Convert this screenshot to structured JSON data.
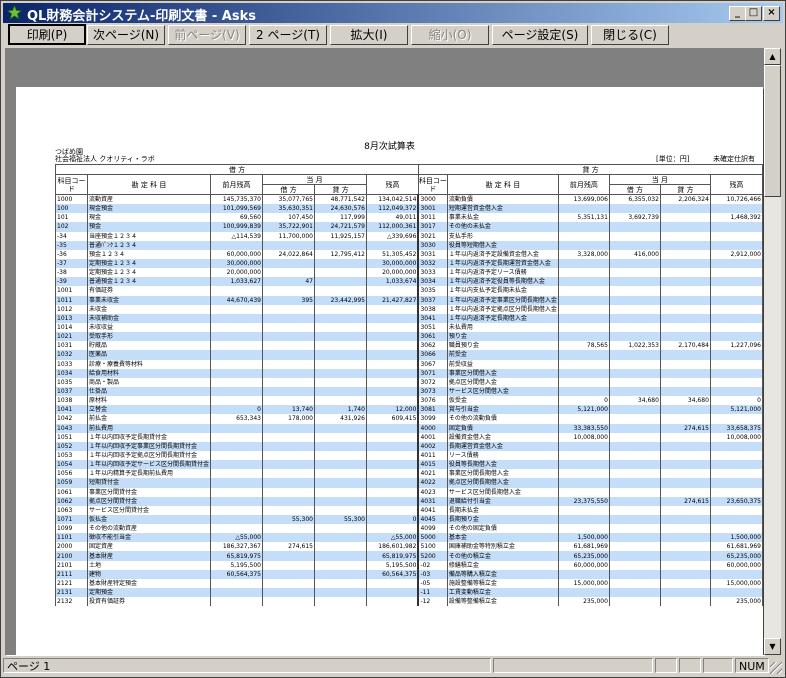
{
  "window": {
    "title": "QL財務会計システム-印刷文書 - Asks",
    "min_icon": "minimize-icon",
    "max_icon": "maximize-icon",
    "close_icon": "close-icon"
  },
  "toolbar": {
    "print": "印刷(P)",
    "next_page": "次ページ(N)",
    "prev_page": "前ページ(V)",
    "two_page": "2 ページ(T)",
    "zoom_in": "拡大(I)",
    "zoom_out": "縮小(O)",
    "page_setup": "ページ設定(S)",
    "close": "閉じる(C)"
  },
  "document": {
    "title": "8月次試算表",
    "company1": "つばめ園",
    "company2": "社会福祉法人 クオリティ・ラボ",
    "unit": "[単位：円]",
    "status": "未確定仕訳有",
    "left_header": "借 方",
    "right_header": "貸 方",
    "col_code": "科目コード",
    "col_name": "勘 定 科 目",
    "col_prev": "前月残高",
    "col_month": "当 月",
    "col_debit": "借 方",
    "col_credit": "貸 方",
    "col_bal": "残高",
    "rows": [
      [
        "1000",
        "流動資産",
        "145,735,370",
        "35,077,765",
        "48,771,542",
        "134,042,514",
        "3000",
        "流動負債",
        "13,699,006",
        "6,355,032",
        "2,206,324",
        "10,726,466"
      ],
      [
        "100",
        "現金預金",
        "101,099,569",
        "35,630,351",
        "24,630,576",
        "112,049,372",
        "3001",
        "短期運営資金借入金",
        "",
        "",
        "",
        ""
      ],
      [
        "101",
        "現金",
        "69,560",
        "107,450",
        "117,999",
        "49,011",
        "3011",
        "事業未払金",
        "5,351,131",
        "3,692,739",
        "",
        "1,468,392"
      ],
      [
        "102",
        "預金",
        "100,999,839",
        "35,722,901",
        "24,721,579",
        "112,000,361",
        "3017",
        "その他の未払金",
        "",
        "",
        "",
        ""
      ],
      [
        "-34",
        "当座預金１２３４",
        "△114,539",
        "11,700,000",
        "11,925,157",
        "△339,696",
        "3021",
        "支払手形",
        "",
        "",
        "",
        ""
      ],
      [
        "-35",
        "普通ﾊﾞﾝｸ１２３４",
        "",
        "",
        "",
        "",
        "3030",
        "役員等短期借入金",
        "",
        "",
        "",
        ""
      ],
      [
        "-36",
        "預金１２３４",
        "60,000,000",
        "24,022,864",
        "12,795,412",
        "51,305,452",
        "3031",
        "１年以内返済予定設備資金借入金",
        "3,328,000",
        "416,000",
        "",
        "2,912,000"
      ],
      [
        "-37",
        "定期預金１２３４",
        "30,000,000",
        "",
        "",
        "30,000,000",
        "3032",
        "１年以内返済予定長期運営資金借入金",
        "",
        "",
        "",
        ""
      ],
      [
        "-38",
        "定期預金１２３４",
        "20,000,000",
        "",
        "",
        "20,000,000",
        "3033",
        "１年以内返済予定リース債務",
        "",
        "",
        "",
        ""
      ],
      [
        "-39",
        "普通預金１２３４",
        "1,033,627",
        "47",
        "",
        "1,033,674",
        "3034",
        "１年以内返済予定役員等長期借入金",
        "",
        "",
        "",
        ""
      ],
      [
        "1001",
        "有価証券",
        "",
        "",
        "",
        "",
        "3035",
        "１年以内支払予定長期未払金",
        "",
        "",
        "",
        ""
      ],
      [
        "1011",
        "事業未収金",
        "44,670,439",
        "395",
        "23,442,995",
        "21,427,827",
        "3037",
        "１年以内返済予定事業区分間長期借入金",
        "",
        "",
        "",
        ""
      ],
      [
        "1012",
        "未収金",
        "",
        "",
        "",
        "",
        "3038",
        "１年以内返済予定拠点区分間長期借入金",
        "",
        "",
        "",
        ""
      ],
      [
        "1013",
        "未収補助金",
        "",
        "",
        "",
        "",
        "3041",
        "１年以内返済予定長期借入金",
        "",
        "",
        "",
        ""
      ],
      [
        "1014",
        "未収収益",
        "",
        "",
        "",
        "",
        "3051",
        "未払費用",
        "",
        "",
        "",
        ""
      ],
      [
        "1021",
        "受取手形",
        "",
        "",
        "",
        "",
        "3061",
        "預り金",
        "",
        "",
        "",
        ""
      ],
      [
        "1031",
        "貯蔵品",
        "",
        "",
        "",
        "",
        "3062",
        "職員預り金",
        "78,565",
        "1,022,353",
        "2,170,484",
        "1,227,096"
      ],
      [
        "1032",
        "医薬品",
        "",
        "",
        "",
        "",
        "3066",
        "前受金",
        "",
        "",
        "",
        ""
      ],
      [
        "1033",
        "診療・療養費等材料",
        "",
        "",
        "",
        "",
        "3067",
        "前受収益",
        "",
        "",
        "",
        ""
      ],
      [
        "1034",
        "給食用材料",
        "",
        "",
        "",
        "",
        "3071",
        "事業区分間借入金",
        "",
        "",
        "",
        ""
      ],
      [
        "1035",
        "商品・製品",
        "",
        "",
        "",
        "",
        "3072",
        "拠点区分間借入金",
        "",
        "",
        "",
        ""
      ],
      [
        "1037",
        "仕掛品",
        "",
        "",
        "",
        "",
        "3073",
        "サービス区分間借入金",
        "",
        "",
        "",
        ""
      ],
      [
        "1038",
        "原材料",
        "",
        "",
        "",
        "",
        "3076",
        "仮受金",
        "0",
        "34,680",
        "34,680",
        "0"
      ],
      [
        "1041",
        "立替金",
        "0",
        "13,740",
        "1,740",
        "12,000",
        "3081",
        "賞与引当金",
        "5,121,000",
        "",
        "",
        "5,121,000"
      ],
      [
        "1042",
        "前払金",
        "653,343",
        "178,000",
        "431,926",
        "609,415",
        "3099",
        "その他の流動負債",
        "",
        "",
        "",
        ""
      ],
      [
        "1043",
        "前払費用",
        "",
        "",
        "",
        "",
        "4000",
        "固定負債",
        "33,383,550",
        "",
        "274,615",
        "33,658,375"
      ],
      [
        "1051",
        "１年以内回収予定長期貸付金",
        "",
        "",
        "",
        "",
        "4001",
        "設備資金借入金",
        "10,008,000",
        "",
        "",
        "10,008,000"
      ],
      [
        "1052",
        "１年以内回収予定事業区分間長期貸付金",
        "",
        "",
        "",
        "",
        "4002",
        "長期運営資金借入金",
        "",
        "",
        "",
        ""
      ],
      [
        "1053",
        "１年以内回収予定拠点区分間長期貸付金",
        "",
        "",
        "",
        "",
        "4011",
        "リース債務",
        "",
        "",
        "",
        ""
      ],
      [
        "1054",
        "１年以内回収予定サービス区分間長期貸付金",
        "",
        "",
        "",
        "",
        "4015",
        "役員等長期借入金",
        "",
        "",
        "",
        ""
      ],
      [
        "1056",
        "１年以内精算予定長期前払費用",
        "",
        "",
        "",
        "",
        "4021",
        "事業区分間長期借入金",
        "",
        "",
        "",
        ""
      ],
      [
        "1059",
        "短期貸付金",
        "",
        "",
        "",
        "",
        "4022",
        "拠点区分間長期借入金",
        "",
        "",
        "",
        ""
      ],
      [
        "1061",
        "事業区分間貸付金",
        "",
        "",
        "",
        "",
        "4023",
        "サービス区分間長期借入金",
        "",
        "",
        "",
        ""
      ],
      [
        "1062",
        "拠点区分間貸付金",
        "",
        "",
        "",
        "",
        "4031",
        "退職給付引当金",
        "23,375,550",
        "",
        "274,615",
        "23,650,375"
      ],
      [
        "1063",
        "サービス区分間貸付金",
        "",
        "",
        "",
        "",
        "4041",
        "長期未払金",
        "",
        "",
        "",
        ""
      ],
      [
        "1071",
        "仮払金",
        "",
        "55,300",
        "55,300",
        "0",
        "4045",
        "長期預り金",
        "",
        "",
        "",
        ""
      ],
      [
        "1099",
        "その他の流動資産",
        "",
        "",
        "",
        "",
        "4099",
        "その他の固定負債",
        "",
        "",
        "",
        ""
      ],
      [
        "1101",
        "徴収不能引当金",
        "△55,000",
        "",
        "",
        "△55,000",
        "5000",
        "基本金",
        "1,500,000",
        "",
        "",
        "1,500,000"
      ],
      [
        "2000",
        "固定資産",
        "186,327,367",
        "274,615",
        "",
        "186,601,982",
        "5100",
        "国庫補助金等特別積立金",
        "61,681,969",
        "",
        "",
        "61,681,969"
      ],
      [
        "2100",
        "基本財産",
        "65,819,975",
        "",
        "",
        "65,819,975",
        "5200",
        "その他の積立金",
        "65,235,000",
        "",
        "",
        "65,235,000"
      ],
      [
        "2101",
        "土地",
        "5,195,500",
        "",
        "",
        "5,195,500",
        "-02",
        "修繕積立金",
        "60,000,000",
        "",
        "",
        "60,000,000"
      ],
      [
        "2111",
        "建物",
        "60,564,375",
        "",
        "",
        "60,564,375",
        "-03",
        "備品等購入積立金",
        "",
        "",
        "",
        ""
      ],
      [
        "2121",
        "基本財産特定預金",
        "",
        "",
        "",
        "",
        "-05",
        "施設整備等積立金",
        "15,000,000",
        "",
        "",
        "15,000,000"
      ],
      [
        "2131",
        "定期預金",
        "",
        "",
        "",
        "",
        "-11",
        "工賃変動積立金",
        "",
        "",
        "",
        ""
      ],
      [
        "2132",
        "投資有価証券",
        "",
        "",
        "",
        "",
        "-12",
        "設備等整備積立金",
        "235,000",
        "",
        "",
        "235,000"
      ]
    ]
  },
  "statusbar": {
    "page": "ページ 1",
    "num": "NUM"
  }
}
